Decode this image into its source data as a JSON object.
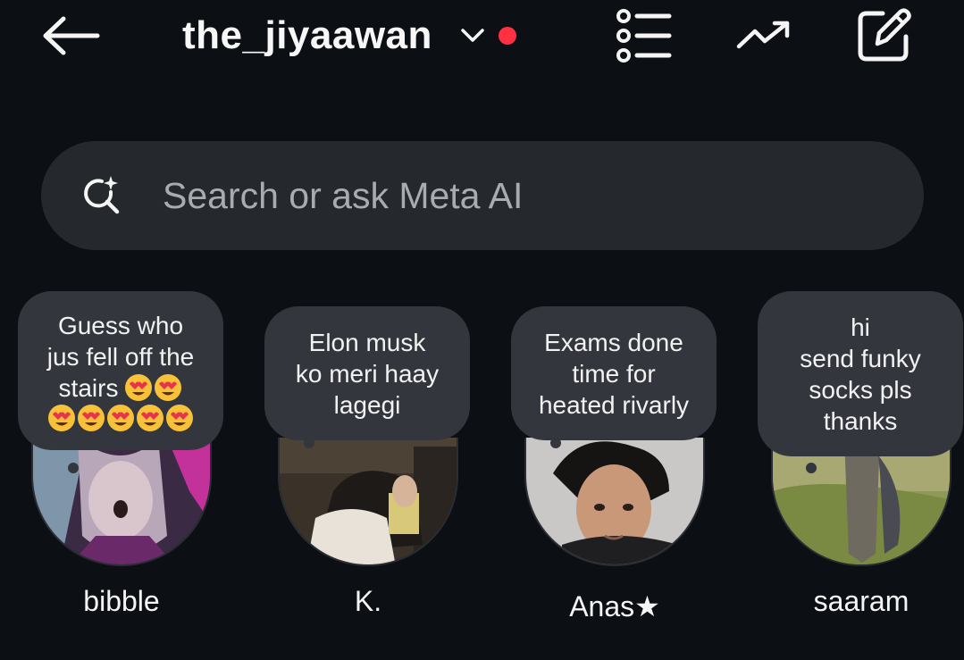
{
  "header": {
    "username": "the_jiyaawan",
    "icons": [
      "back-arrow-icon",
      "chevron-down-icon",
      "notification-dot",
      "list-icon",
      "trending-icon",
      "edit-icon"
    ]
  },
  "search": {
    "placeholder": "Search or ask Meta AI",
    "icon": "meta-ai-search-icon"
  },
  "notes": [
    {
      "name": "bibble",
      "note_lines": [
        "Guess who",
        "jus fell off the",
        "stairs"
      ],
      "note_emoji": "😍😍😍😍😍😍😍",
      "avatar": "cartoon-character-avatar"
    },
    {
      "name": "K.",
      "note_lines": [
        "Elon musk",
        "ko meri haay",
        "lagegi"
      ],
      "avatar": "person-reading-avatar"
    },
    {
      "name": "Anas★",
      "note_lines": [
        "Exams done",
        "time for",
        "heated rivarly"
      ],
      "avatar": "selfie-avatar"
    },
    {
      "name": "saaram",
      "note_lines": [
        "hi",
        "send funky",
        "socks pls",
        "thanks"
      ],
      "avatar": "outdoor-figure-avatar"
    }
  ],
  "colors": {
    "background": "#0c0f14",
    "search_bg": "#25292e",
    "bubble_bg": "#33373d",
    "accent_red": "#ff3040",
    "text": "#f5f5f5",
    "placeholder": "#a8abb0"
  }
}
